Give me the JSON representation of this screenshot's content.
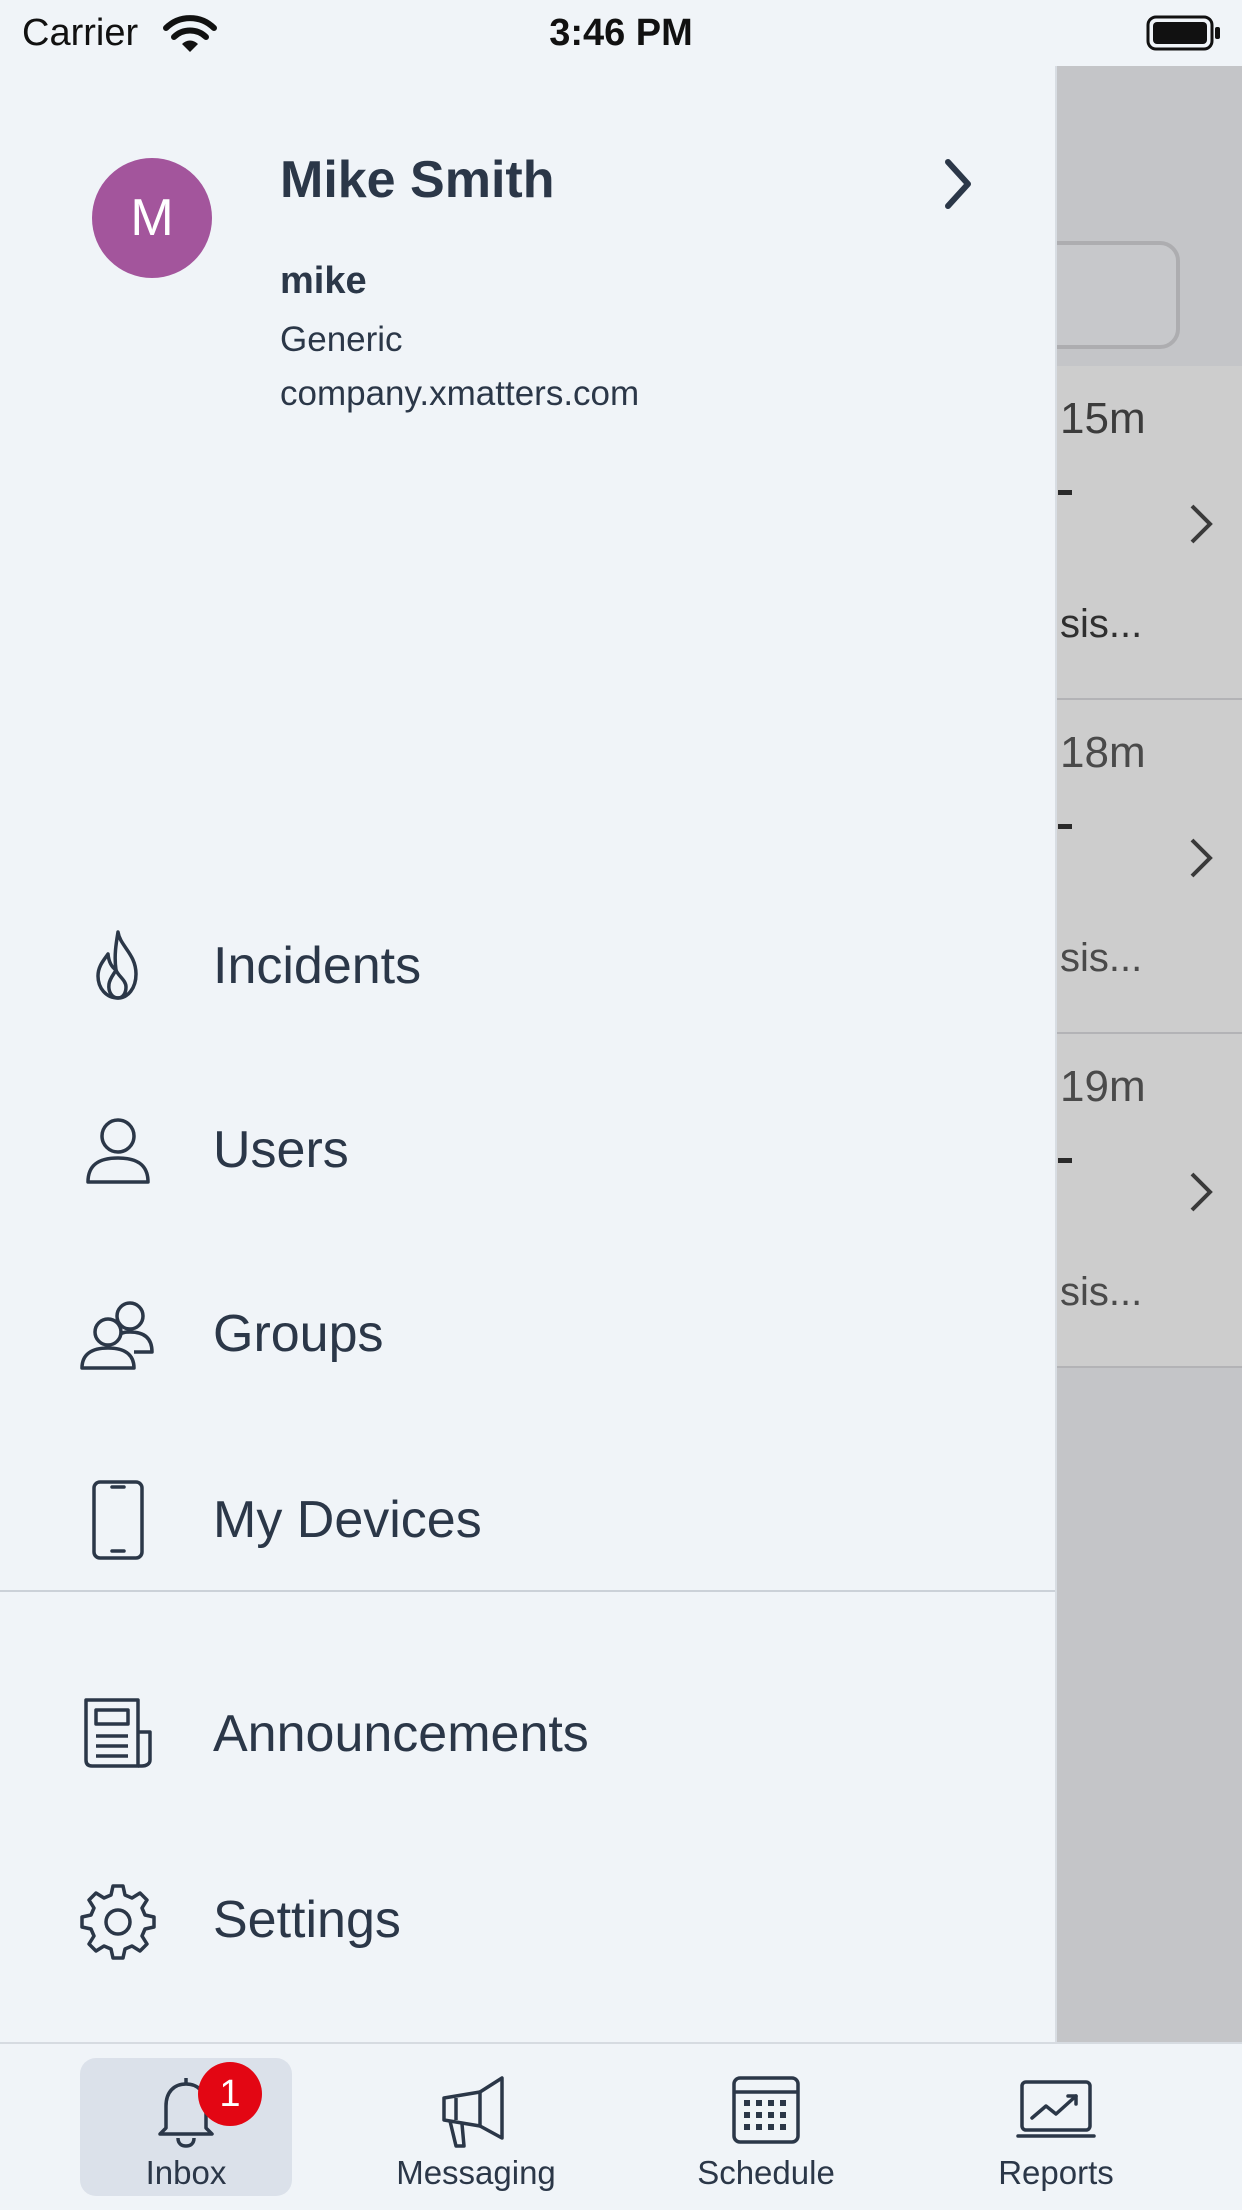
{
  "status_bar": {
    "carrier": "Carrier",
    "time": "3:46 PM"
  },
  "profile": {
    "avatar_initial": "M",
    "name": "Mike Smith",
    "login": "mike",
    "role": "Generic",
    "domain": "company.xmatters.com"
  },
  "menu": {
    "items": [
      {
        "label": "Incidents",
        "icon": "flame-icon"
      },
      {
        "label": "Users",
        "icon": "user-icon"
      },
      {
        "label": "Groups",
        "icon": "group-icon"
      },
      {
        "label": "My Devices",
        "icon": "phone-icon"
      },
      {
        "label": "Announcements",
        "icon": "newspaper-icon"
      },
      {
        "label": "Settings",
        "icon": "gear-icon"
      }
    ]
  },
  "background_list": {
    "rows": [
      {
        "age": "15m",
        "snippet": "sis..."
      },
      {
        "age": "18m",
        "snippet": "sis..."
      },
      {
        "age": "19m",
        "snippet": "sis..."
      }
    ]
  },
  "tab_bar": {
    "tabs": [
      {
        "label": "Inbox",
        "icon": "bell-icon",
        "badge": "1",
        "active": true
      },
      {
        "label": "Messaging",
        "icon": "megaphone-icon"
      },
      {
        "label": "Schedule",
        "icon": "calendar-icon"
      },
      {
        "label": "Reports",
        "icon": "chart-icon"
      }
    ]
  },
  "colors": {
    "avatar": "#a3559c",
    "text": "#2b3748",
    "badge": "#e30613",
    "drawer_bg": "#f0f4f8",
    "overlay": "#c4c5c8"
  }
}
